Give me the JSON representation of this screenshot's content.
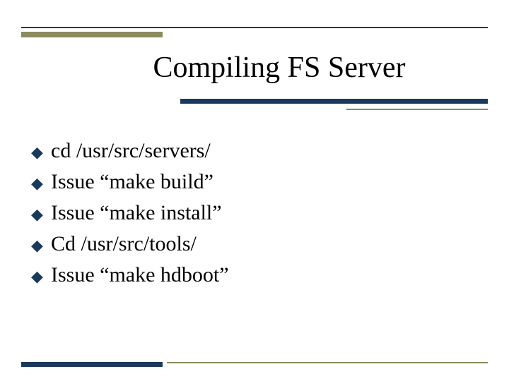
{
  "title": "Compiling FS Server",
  "bullets": [
    "cd /usr/src/servers/",
    "Issue “make build”",
    "Issue “make install”",
    "Cd /usr/src/tools/",
    "Issue “make hdboot”"
  ]
}
